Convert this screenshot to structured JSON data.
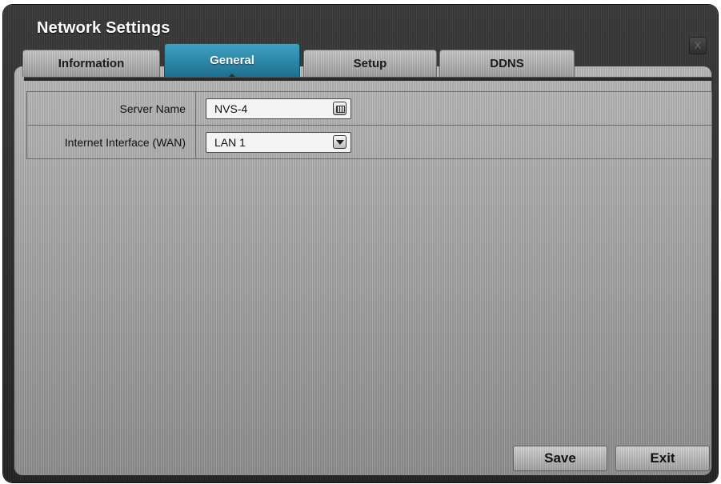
{
  "window": {
    "title": "Network Settings",
    "close_label": "X"
  },
  "tabs": [
    {
      "label": "Information",
      "active": false
    },
    {
      "label": "General",
      "active": true
    },
    {
      "label": "Setup",
      "active": false
    },
    {
      "label": "DDNS",
      "active": false
    }
  ],
  "form": {
    "server_name": {
      "label": "Server Name",
      "value": "NVS-4",
      "icon": "keyboard-icon"
    },
    "wan": {
      "label": "Internet Interface (WAN)",
      "value": "LAN 1",
      "icon": "chevron-down-icon"
    }
  },
  "buttons": {
    "save": "Save",
    "exit": "Exit"
  },
  "colors": {
    "active_tab": "#2a87a8",
    "window_bg": "#2e2e2e",
    "panel_bg": "#a3a3a3"
  }
}
